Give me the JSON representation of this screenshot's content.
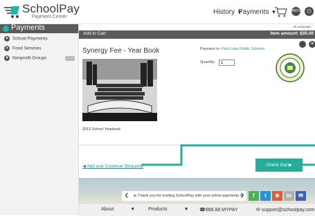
{
  "header": {
    "logo_title": "SchoolPay",
    "logo_sub": "Payment Center",
    "nav_history": "History",
    "nav_payments": "Payments",
    "user_badge": "ABOUT",
    "colors": {
      "accent": "#1cb9a4",
      "dark": "#5a5a5a"
    }
  },
  "sidebar": {
    "title": "Payments",
    "items": [
      {
        "label": "School Payments",
        "icon": "graduation-icon"
      },
      {
        "label": "Food Services",
        "icon": "food-icon"
      },
      {
        "label": "Nonprofit Groups",
        "icon": "heart-icon"
      }
    ]
  },
  "main": {
    "language": "Language",
    "titlebar_left": "Add to Cart",
    "titlebar_right": "Item amount: $35.00",
    "item_title": "Synergy Fee - Year Book",
    "payment_to_label": "Payment to:",
    "payment_to_value": "Park Lake Public Schools",
    "quantity_label": "Quantity:",
    "quantity_value": "1",
    "caption": "2013 School Yearbook",
    "add_continue": "Add and Continue Shopping",
    "checkout": "Check Out"
  },
  "footer": {
    "ticker": "Thank you for trusting SchoolPay with your online payments in",
    "about": "About",
    "products": "Products",
    "phone": "888.88.MYPAY",
    "email": "support@schoolpay.com"
  }
}
